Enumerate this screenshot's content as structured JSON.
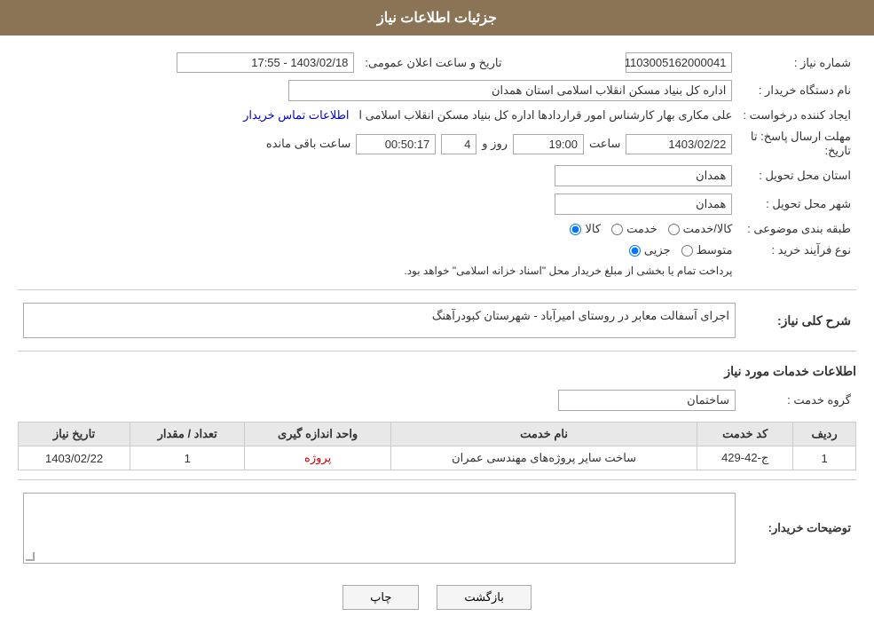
{
  "header": {
    "title": "جزئیات اطلاعات نیاز"
  },
  "fields": {
    "need_number_label": "شماره نیاز :",
    "need_number_value": "1103005162000041",
    "buyer_org_label": "نام دستگاه خریدار :",
    "buyer_org_value": "اداره کل بنیاد مسکن انقلاب اسلامی استان همدان",
    "requester_label": "ایجاد کننده درخواست :",
    "requester_name": "علی مکاری بهار کارشناس امور قراردادها اداره کل بنیاد مسکن انقلاب اسلامی ا",
    "requester_link": "اطلاعات تماس خریدار",
    "deadline_label": "مهلت ارسال پاسخ: تا تاریخ:",
    "date_value": "1403/02/22",
    "time_label": "ساعت",
    "time_value": "19:00",
    "days_label": "روز و",
    "days_value": "4",
    "remaining_label": "ساعت باقی مانده",
    "remaining_value": "00:50:17",
    "public_announce_label": "تاریخ و ساعت اعلان عمومی:",
    "public_announce_value": "1403/02/18 - 17:55",
    "province_label": "استان محل تحویل :",
    "province_value": "همدان",
    "city_label": "شهر محل تحویل :",
    "city_value": "همدان",
    "category_label": "طبقه بندی موضوعی :",
    "radio_kala": "کالا",
    "radio_khedmat": "خدمت",
    "radio_kala_khedmat": "کالا/خدمت",
    "purchase_type_label": "نوع فرآیند خرید :",
    "radio_jozvi": "جزیی",
    "radio_motevaset": "متوسط",
    "purchase_note": "پرداخت تمام یا بخشی از مبلغ خریدار محل \"اسناد خزانه اسلامی\" خواهد بود.",
    "general_desc_label": "شرح کلی نیاز:",
    "general_desc_value": "اجرای آسفالت معابر در روستای امیرآباد - شهرستان کبودرآهنگ",
    "services_section_label": "اطلاعات خدمات مورد نیاز",
    "service_group_label": "گروه خدمت :",
    "service_group_value": "ساختمان",
    "table": {
      "col_row": "ردیف",
      "col_code": "کد خدمت",
      "col_name": "نام خدمت",
      "col_unit": "واحد اندازه گیری",
      "col_count": "تعداد / مقدار",
      "col_date": "تاریخ نیاز",
      "rows": [
        {
          "row": "1",
          "code": "ج-42-429",
          "name": "ساخت سایر پروژه‌های مهندسی عمران",
          "unit": "پروژه",
          "count": "1",
          "date": "1403/02/22"
        }
      ]
    },
    "buyer_desc_label": "توضیحات خریدار:",
    "buyer_desc_value": ""
  },
  "buttons": {
    "print": "چاپ",
    "back": "بازگشت"
  },
  "colors": {
    "header_bg": "#8b7355",
    "link_blue": "#0000cc",
    "link_red": "#cc0000"
  }
}
